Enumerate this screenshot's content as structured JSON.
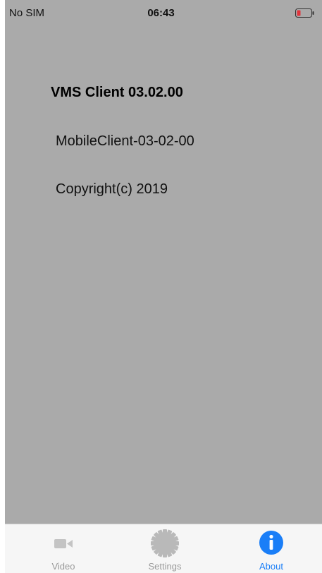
{
  "status_bar": {
    "carrier": "No SIM",
    "time": "06:43",
    "battery_icon": "battery-low-icon",
    "battery_color": "#e0343c"
  },
  "about": {
    "title": "VMS Client 03.02.00",
    "version": "MobileClient-03-02-00",
    "copyright": "Copyright(c) 2019"
  },
  "tab_bar": {
    "active_color": "#1a7ef7",
    "inactive_color": "#9a9a9a",
    "tabs": [
      {
        "label": "Video",
        "icon": "video-camera-icon",
        "active": false
      },
      {
        "label": "Settings",
        "icon": "gear-icon",
        "active": false
      },
      {
        "label": "About",
        "icon": "info-icon",
        "active": true
      }
    ]
  }
}
